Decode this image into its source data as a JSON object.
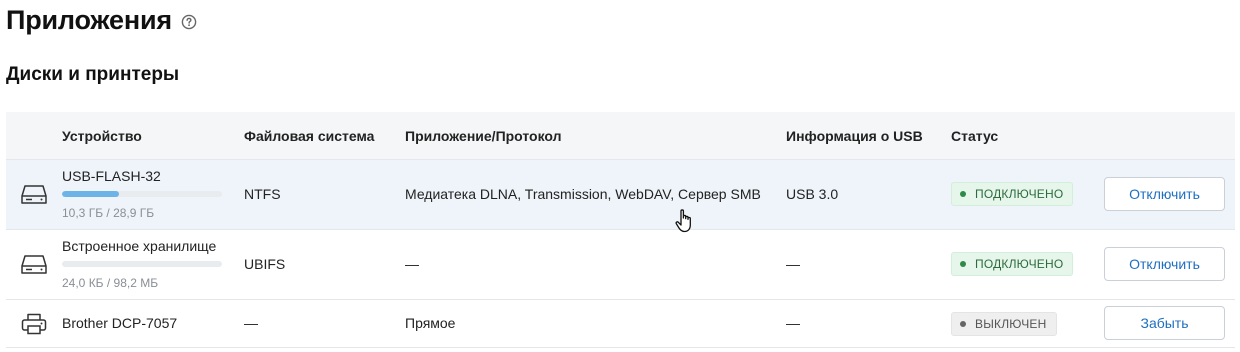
{
  "page": {
    "title": "Приложения",
    "help_icon": "question-circle-icon"
  },
  "section": {
    "title": "Диски и принтеры"
  },
  "table": {
    "headers": {
      "device": "Устройство",
      "filesystem": "Файловая система",
      "app_protocol": "Приложение/Протокол",
      "usb_info": "Информация о USB",
      "status": "Статус"
    },
    "rows": [
      {
        "icon": "drive-icon",
        "name": "USB-FLASH-32",
        "usage_text": "10,3 ГБ / 28,9 ГБ",
        "usage_fraction": 0.356,
        "filesystem": "NTFS",
        "app_protocol": "Медиатека DLNA, Transmission, WebDAV, Сервер SMB",
        "usb_info": "USB 3.0",
        "status": "ПОДКЛЮЧЕНО",
        "status_state": "connected",
        "action": "Отключить"
      },
      {
        "icon": "drive-icon",
        "name": "Встроенное хранилище",
        "usage_text": "24,0 КБ / 98,2 МБ",
        "usage_fraction": 0.0002,
        "filesystem": "UBIFS",
        "app_protocol": "—",
        "usb_info": "—",
        "status": "ПОДКЛЮЧЕНО",
        "status_state": "connected",
        "action": "Отключить"
      },
      {
        "icon": "printer-icon",
        "name": "Brother DCP-7057",
        "filesystem": "—",
        "app_protocol": "Прямое",
        "usb_info": "—",
        "status": "ВЫКЛЮЧЕН",
        "status_state": "off",
        "action": "Забыть"
      }
    ]
  },
  "colors": {
    "accent": "#1f6fc0",
    "usage_fill": "#6db3e8",
    "status_connected_dot": "#2f8a4a",
    "status_off_dot": "#666666",
    "hover_row": "#eef4fa",
    "header_bg": "#f4f6f8"
  },
  "cursor": "hand-pointer-icon"
}
